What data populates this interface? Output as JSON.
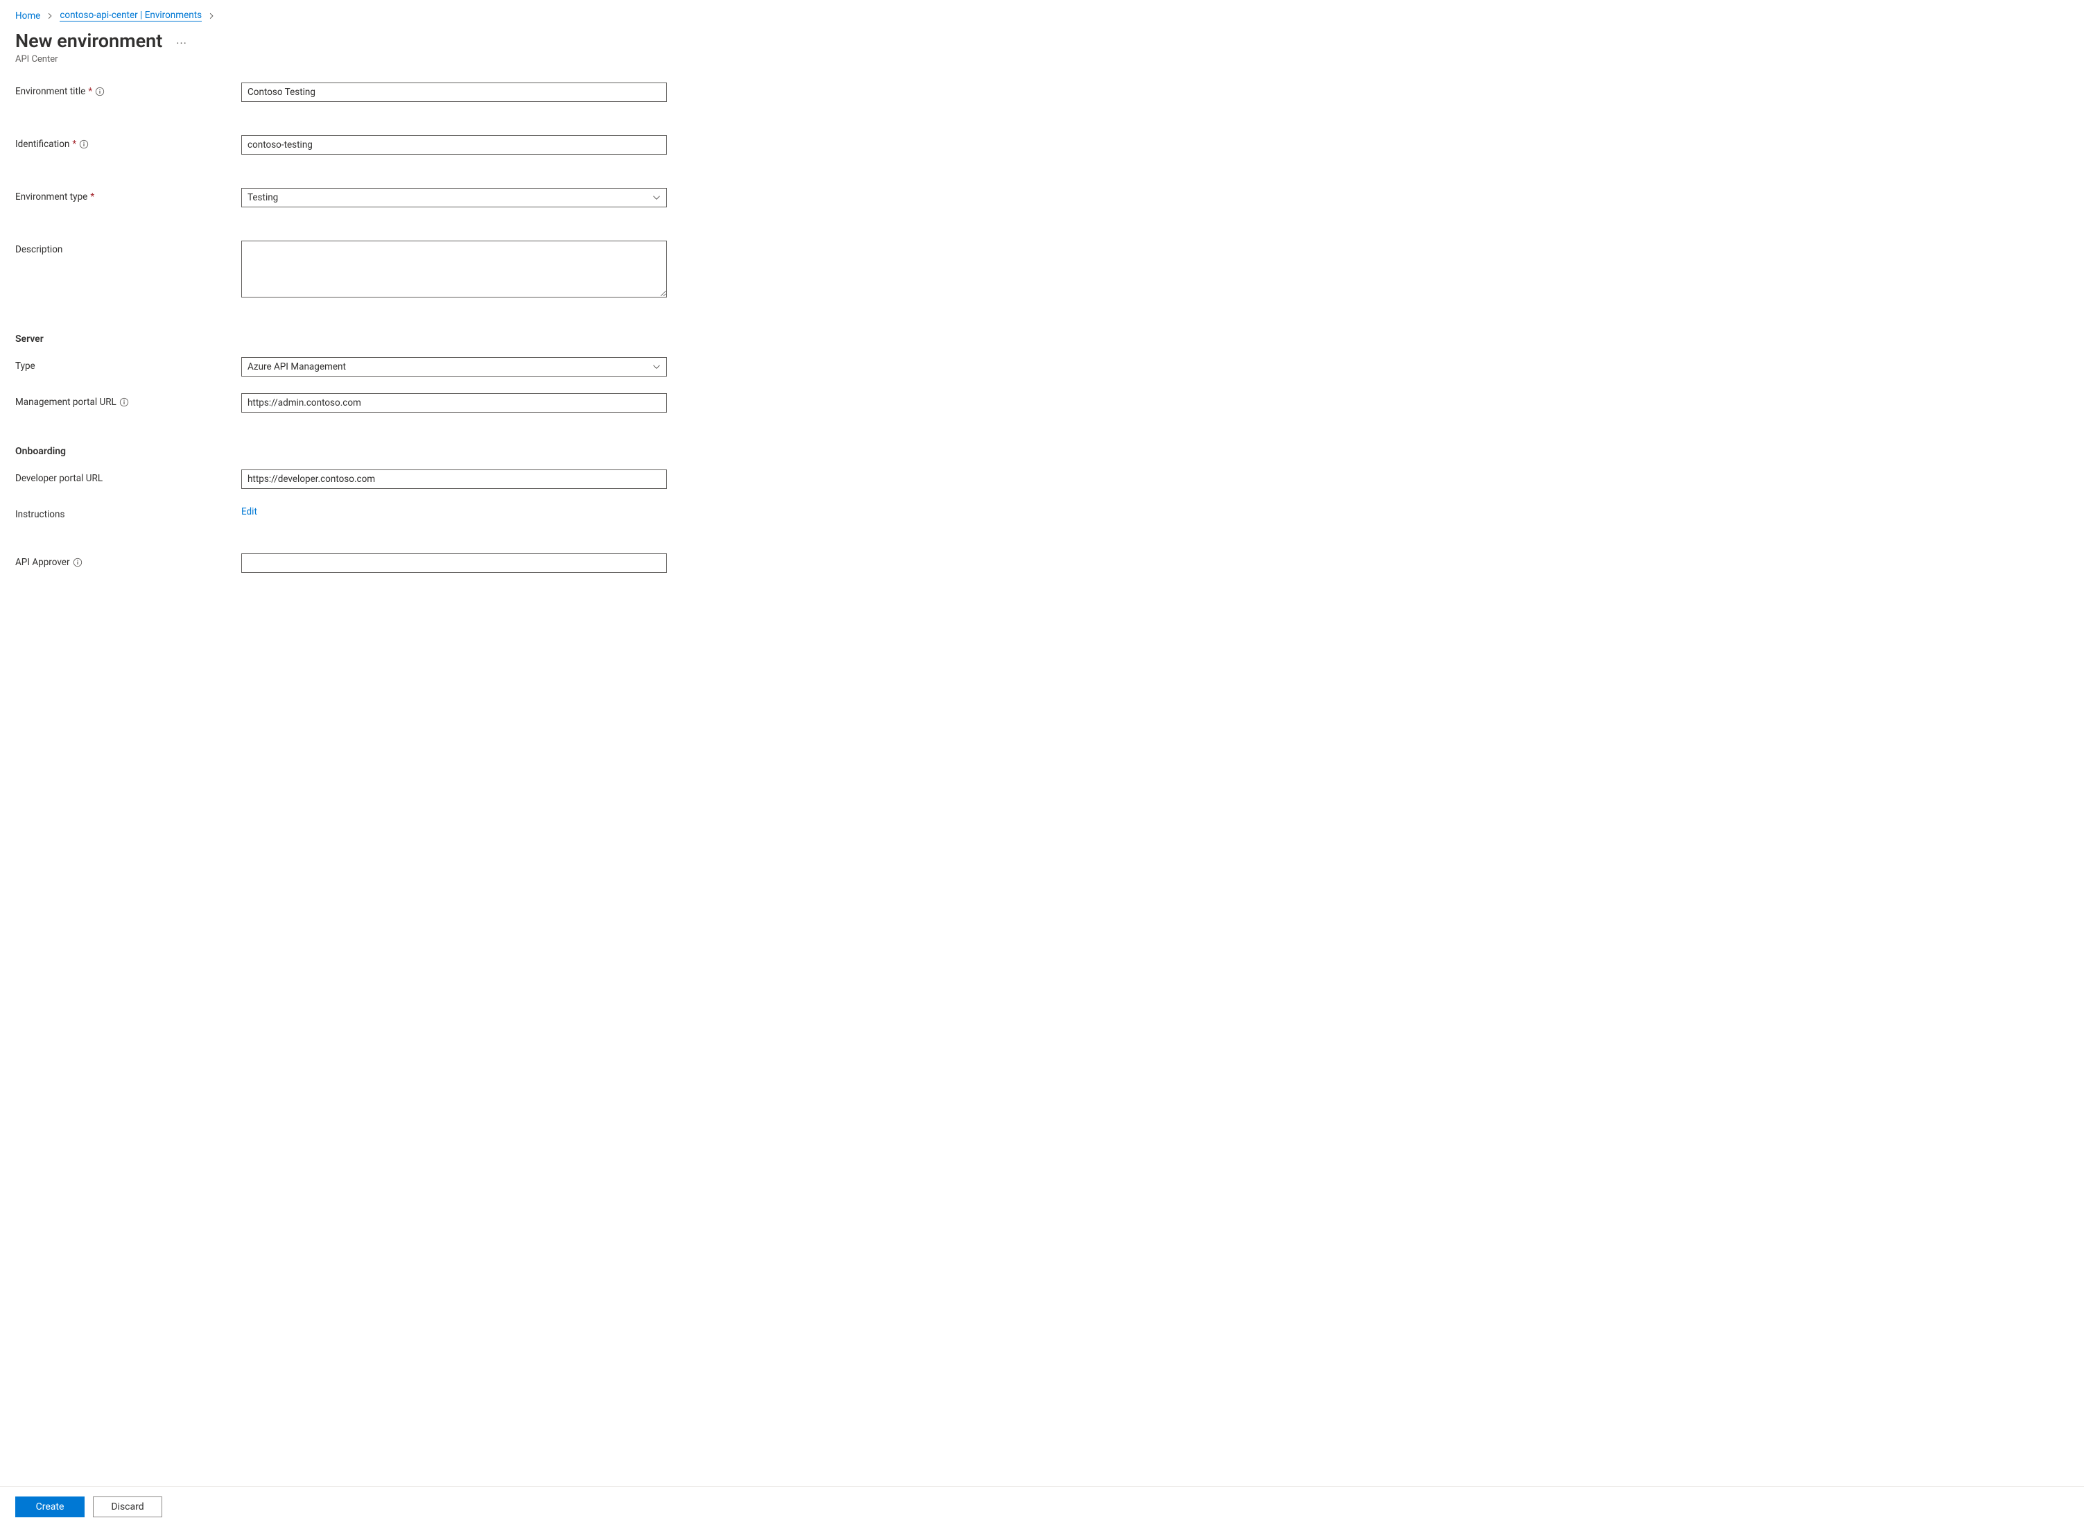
{
  "breadcrumb": {
    "home": "Home",
    "resource": "contoso-api-center | Environments"
  },
  "page": {
    "title": "New environment",
    "subtitle": "API Center"
  },
  "labels": {
    "environment_title": "Environment title",
    "identification": "Identification",
    "environment_type": "Environment type",
    "description": "Description",
    "server_section": "Server",
    "server_type": "Type",
    "management_portal_url": "Management portal URL",
    "onboarding_section": "Onboarding",
    "developer_portal_url": "Developer portal URL",
    "instructions": "Instructions",
    "api_approver": "API Approver"
  },
  "values": {
    "environment_title": "Contoso Testing",
    "identification": "contoso-testing",
    "environment_type": "Testing",
    "description": "",
    "server_type": "Azure API Management",
    "management_portal_url": "https://admin.contoso.com",
    "developer_portal_url": "https://developer.contoso.com",
    "api_approver": ""
  },
  "actions": {
    "instructions_edit": "Edit",
    "create": "Create",
    "discard": "Discard",
    "more": "···"
  }
}
